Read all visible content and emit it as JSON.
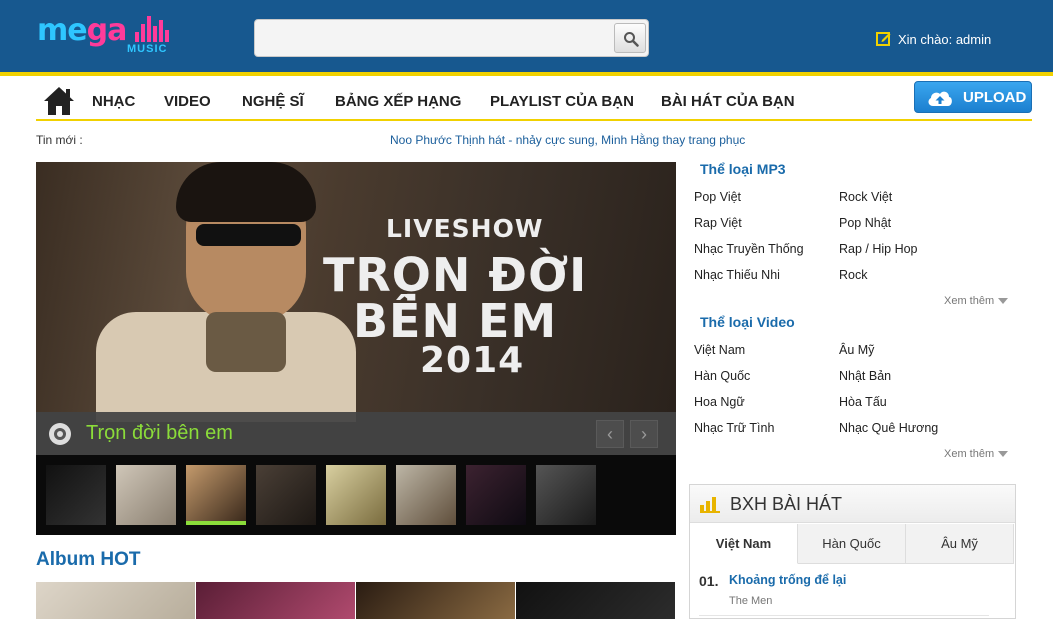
{
  "header": {
    "logo_text_a": "me",
    "logo_text_b": "ga",
    "logo_sub": "MUSIC",
    "search_placeholder": "",
    "greeting": "Xin chào: admin"
  },
  "nav": {
    "items": [
      "NHẠC",
      "VIDEO",
      "NGHỆ SĨ",
      "BẢNG XẾP HẠNG",
      "PLAYLIST CỦA BẠN",
      "BÀI HÁT CỦA BẠN"
    ],
    "upload_label": "UPLOAD"
  },
  "ticker": {
    "label": "Tin mới :",
    "text": "Noo Phước Thịnh hát - nhảy cực sung, Minh Hằng thay trang phục"
  },
  "slider": {
    "banner_line1": "LIVESHOW",
    "banner_line2": "TRỌN ĐỜI",
    "banner_line3": "BÊN EM",
    "banner_line4": "2014",
    "caption": "Trọn đời bên em",
    "prev_symbol": "‹",
    "next_symbol": "›",
    "thumb_count": 8,
    "active_thumb": 2
  },
  "album": {
    "heading": "Album HOT"
  },
  "genres_mp3": {
    "heading": "Thể loại MP3",
    "left": [
      "Pop Việt",
      "Rap Việt",
      "Nhạc Truyền Thống",
      "Nhạc Thiếu Nhi"
    ],
    "right": [
      "Rock Việt",
      "Pop Nhật",
      "Rap / Hip Hop",
      "Rock"
    ],
    "see_more": "Xem thêm"
  },
  "genres_video": {
    "heading": "Thể loại Video",
    "left": [
      "Việt Nam",
      "Hàn Quốc",
      "Hoa Ngữ",
      "Nhạc Trữ Tình"
    ],
    "right": [
      "Âu Mỹ",
      "Nhật Bản",
      "Hòa Tấu",
      "Nhạc Quê Hương"
    ],
    "see_more": "Xem thêm"
  },
  "chart": {
    "title": "BXH BÀI HÁT",
    "tabs": [
      "Việt Nam",
      "Hàn Quốc",
      "Âu Mỹ"
    ],
    "active_tab": 0,
    "entries": [
      {
        "rank": "01.",
        "song": "Khoảng trống để lại",
        "artist": "The Men"
      }
    ]
  },
  "colors": {
    "header_bg": "#17588f",
    "accent_yellow": "#f1d100",
    "link_blue": "#1a6bab",
    "caption_green": "#8bdc3a",
    "upload_blue": "#1b7fcf"
  },
  "icons": [
    "home-icon",
    "search-icon",
    "edit-icon",
    "cloud-upload-icon",
    "disc-icon",
    "bar-chart-icon",
    "caret-down-icon"
  ]
}
